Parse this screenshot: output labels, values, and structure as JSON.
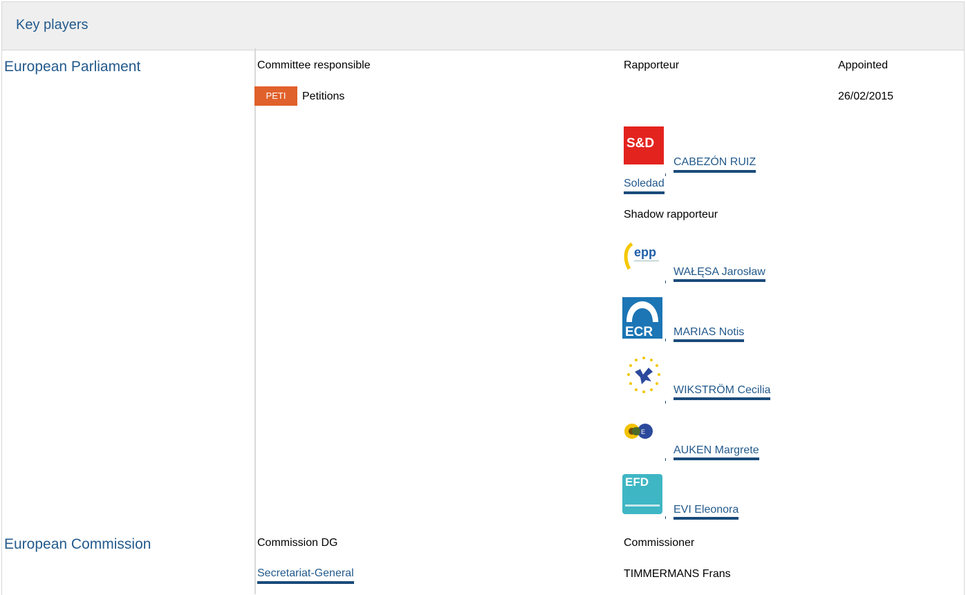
{
  "section_title": "Key players",
  "parliament": {
    "label": "European Parliament",
    "committee_header": "Committee responsible",
    "rapporteur_header": "Rapporteur",
    "appointed_header": "Appointed",
    "committee_code": "PETI",
    "committee_name": "Petitions",
    "appointed_date": "26/02/2015",
    "rapporteur": {
      "party_logo": "S&D",
      "name_line1": "CABEZÓN RUIZ",
      "name_line2": "Soledad"
    },
    "shadow_header": "Shadow rapporteur",
    "shadows": [
      {
        "logo_icon": "epp-logo",
        "logo_text": "epp",
        "name": "WAŁĘSA Jarosław"
      },
      {
        "logo_icon": "ecr-logo",
        "logo_text": "ECR",
        "name": "MARIAS Notis"
      },
      {
        "logo_icon": "alde-logo",
        "logo_text": "",
        "name": "WIKSTRÖM Cecilia"
      },
      {
        "logo_icon": "greens-efa-logo",
        "logo_text": "",
        "name": "AUKEN Margrete"
      },
      {
        "logo_icon": "efdd-logo",
        "logo_text": "EFD",
        "name": "EVI Eleonora"
      }
    ]
  },
  "commission": {
    "label": "European Commission",
    "dg_header": "Commission DG",
    "commissioner_header": "Commissioner",
    "dg_name": "Secretariat-General",
    "commissioner_name": "TIMMERMANS Frans"
  },
  "colors": {
    "link": "#235a8c",
    "committee_badge": "#e0612b",
    "sd_red": "#e3231e",
    "ecr_blue": "#1c75b4",
    "efd_teal": "#3fb6c4"
  }
}
